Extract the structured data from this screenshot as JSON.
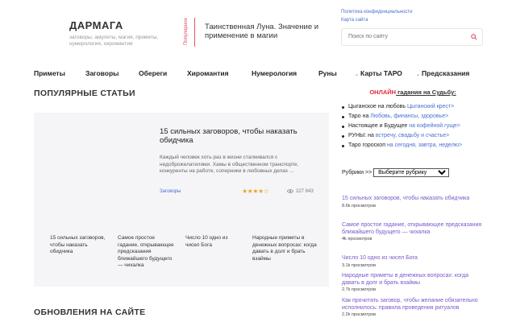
{
  "logo": {
    "title": "ДАРМАГА",
    "subtitle": "заговоры, амулеты, магия, приметы, нумерология, хиромантия"
  },
  "popular_tag": "Популярное",
  "popular_title": "Таинственная Луна. Значение и применение в магии",
  "top_links": [
    "Политика конфиденциальности",
    "Карта сайта"
  ],
  "search": {
    "placeholder": "Поиск по сайту"
  },
  "nav": [
    "Приметы",
    "Заговоры",
    "Обереги",
    "Хиромантия",
    "Нумерология",
    "Руны",
    "Карты ТАРО",
    "Предсказания"
  ],
  "popular_heading": "ПОПУЛЯРНЫЕ СТАТЬИ",
  "featured": {
    "title": "15 сильных заговоров, чтобы наказать обидчика",
    "excerpt": "Каждый человек хоть раз в жизни сталкивался с недоброжелателями. Хамы в общественном транспорте, конкуренты на работе, соперники в любовных делах ...",
    "category": "Заговоры",
    "rating_stars": "★★★★☆",
    "views": "227 843"
  },
  "mini_cards": [
    "15 сильных заговоров, чтобы наказать обидчика",
    "Самое простое гадание, открывающее предсказания ближайшего будущего — чихалка",
    "Число 10 одно из чисел Бога",
    "Народные приметы в денежных вопросах: когда давать в долг и брать взаймы"
  ],
  "updates_heading": "ОБНОВЛЕНИЯ НА САЙТЕ",
  "promo": {
    "prefix": "ОНЛАЙН",
    "text": " гадания на Судьбу:"
  },
  "services": [
    {
      "text": "Цыганское на любовь ",
      "link": "Цыганский крест>"
    },
    {
      "text": "Таро на ",
      "link": "Любовь, финансы, здоровье>"
    },
    {
      "text": "Настоящее и Будущее ",
      "link": "на кофейной гуще>"
    },
    {
      "text": "РУНЫ: на ",
      "link": "встречу, свадьбу и счастье>"
    },
    {
      "text": "Таро гороскоп ",
      "link": "на сегодня, завтра, неделю>"
    }
  ],
  "rubrics": {
    "label": "Рубрики >>",
    "selected": "Выберите рубрику"
  },
  "side_articles": [
    {
      "title": "15 сильных заговоров, чтобы наказать обидчика",
      "views": "8.6k просмотров"
    },
    {
      "title": "Самое простое гадание, открывающее предсказания ближайшего будущего — чихалка",
      "views": "4k просмотров"
    },
    {
      "title": "Число 10 одно из чисел Бога",
      "views": "3.1k просмотров"
    },
    {
      "title": "Народные приметы в денежных вопросах: когда давать в долг и брать взаймы",
      "views": "2.7k просмотров"
    },
    {
      "title": "Как прочитать заговор, чтобы желание обязательно исполнилось: правила проведения ритуалов",
      "views": "2.2k просмотров"
    }
  ]
}
